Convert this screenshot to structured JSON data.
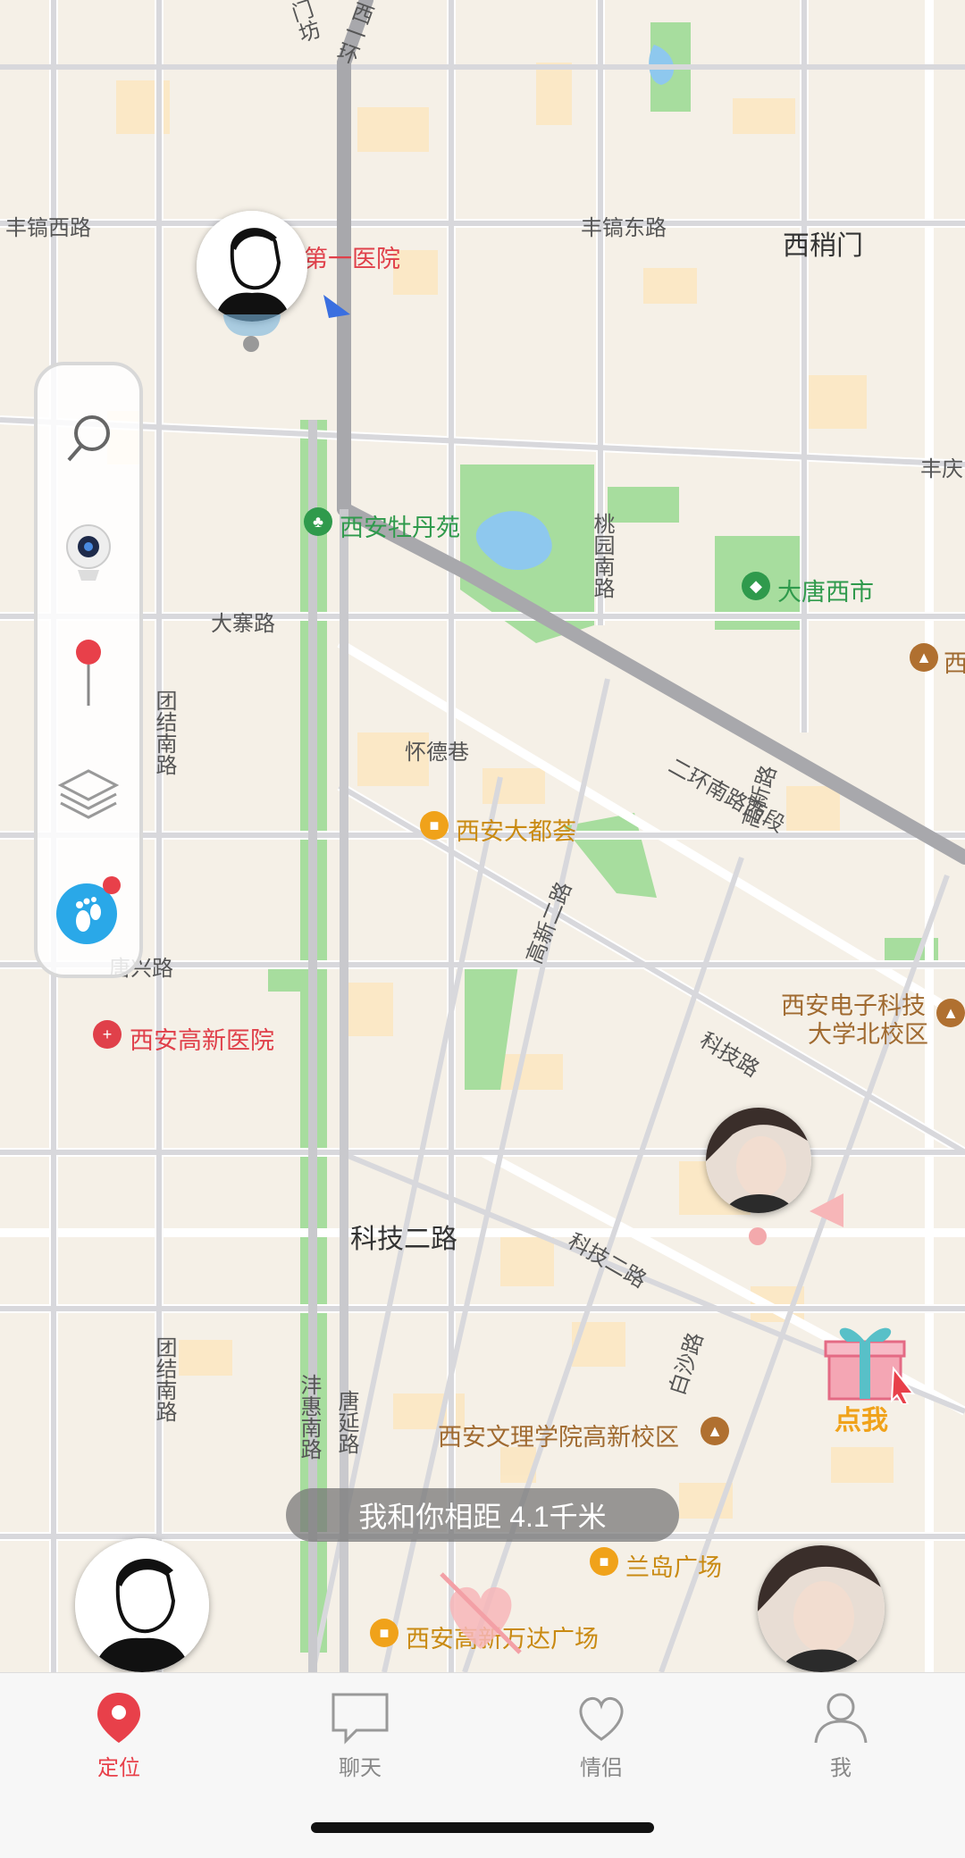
{
  "map": {
    "street_labels": {
      "fengjing_west": "丰镐西路",
      "fengjing_east": "丰镐东路",
      "fengqing": "丰庆",
      "dazhai": "大寨路",
      "tuanjie_south_top": "团结南路",
      "tuanjie_south_bottom": "团结南路",
      "huaide": "怀德巷",
      "taoyuan_south": "桃园南路",
      "second_ring": "二环南路西段",
      "gaoxin_2": "高新二路",
      "gaoxin_road": "高新路",
      "keji_road": "科技路",
      "keji_2_large": "科技二路",
      "keji_2_small": "科技二路",
      "baisha": "白沙路",
      "fenghui_south": "沣惠南路",
      "tangyan": "唐延路",
      "tangxing": "唐兴路",
      "ximenfang": "门坊",
      "xiyi": "西一环"
    },
    "area_labels": {
      "xishaomen": "西稍门"
    },
    "pois": {
      "hospital_top": "第一医院",
      "mudan_garden": "西安牡丹苑",
      "datang_west_market": "大唐西市",
      "xi_partial": "西",
      "dadu_hui": "西安大都荟",
      "gaoxin_hospital": "西安高新医院",
      "xidian_north_1": "西安电子科技",
      "xidian_north_2": "大学北校区",
      "wenli_college": "西安文理学院高新校区",
      "landao_plaza": "兰岛广场",
      "wanda_plaza": "西安高新万达广场"
    }
  },
  "toolbar": {
    "items": [
      "search-icon",
      "camera-icon",
      "pin-icon",
      "layers-icon",
      "footprint-icon"
    ]
  },
  "distance_text": "我和你相距 4.1千米",
  "gift_label": "点我",
  "tabbar": {
    "tabs": [
      {
        "label": "定位",
        "icon": "location-icon",
        "active": true
      },
      {
        "label": "聊天",
        "icon": "chat-icon",
        "active": false
      },
      {
        "label": "情侣",
        "icon": "heart-icon",
        "active": false
      },
      {
        "label": "我",
        "icon": "person-icon",
        "active": false
      }
    ]
  },
  "colors": {
    "accent": "#e8404a",
    "road_main": "#a8a8ac",
    "park": "#8fd58a",
    "water": "#8ec8ee"
  }
}
